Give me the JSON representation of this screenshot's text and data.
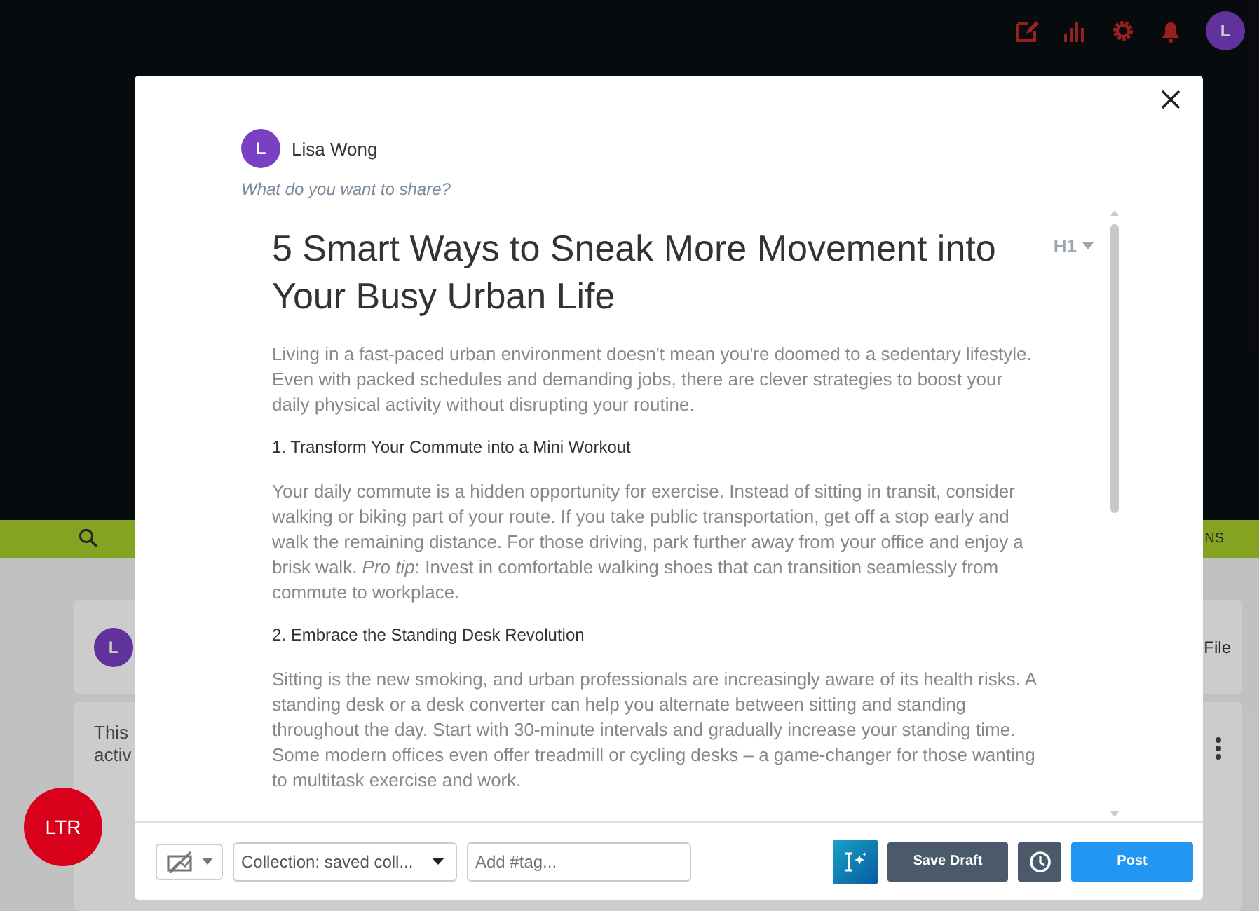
{
  "header": {
    "avatar": "L"
  },
  "nav": {
    "trailing_text": "NS"
  },
  "feed": {
    "composer": {
      "avatar": "L",
      "trailing_text": "File"
    },
    "post": {
      "lines": [
        "This",
        "activ"
      ]
    }
  },
  "ltr_button": "LTR",
  "modal": {
    "author": {
      "initial": "L",
      "name": "Lisa Wong"
    },
    "prompt": "What do you want to share?",
    "heading_level": "H1",
    "article": {
      "title": "5 Smart Ways to Sneak More Movement into Your Busy Urban Life",
      "blocks": [
        {
          "kind": "paragraph",
          "text": "Living in a fast-paced urban environment doesn't mean you're doomed to a sedentary lifestyle. Even with packed schedules and demanding jobs, there are clever strategies to boost your daily physical activity without disrupting your routine."
        },
        {
          "kind": "heading",
          "text": "1. Transform Your Commute into a Mini Workout"
        },
        {
          "kind": "paragraph",
          "text": "Your daily commute is a hidden opportunity for exercise. Instead of sitting in transit, consider walking or biking part of your route. If you take public transportation, get off a stop early and walk the remaining distance. For those driving, park further away from your office and enjoy a brisk walk. *Pro tip*: Invest in comfortable walking shoes that can transition seamlessly from commute to workplace."
        },
        {
          "kind": "heading",
          "text": "2. Embrace the Standing Desk Revolution"
        },
        {
          "kind": "paragraph",
          "text": "Sitting is the new smoking, and urban professionals are increasingly aware of its health risks. A standing desk or a desk converter can help you alternate between sitting and standing throughout the day. Start with 30-minute intervals and gradually increase your standing time. Some modern offices even offer treadmill or cycling desks – a game-changer for those wanting to multitask exercise and work."
        }
      ]
    },
    "footer": {
      "collection": "Collection: saved coll...",
      "tag_placeholder": "Add #tag...",
      "save_draft": "Save Draft",
      "post": "Post"
    }
  }
}
